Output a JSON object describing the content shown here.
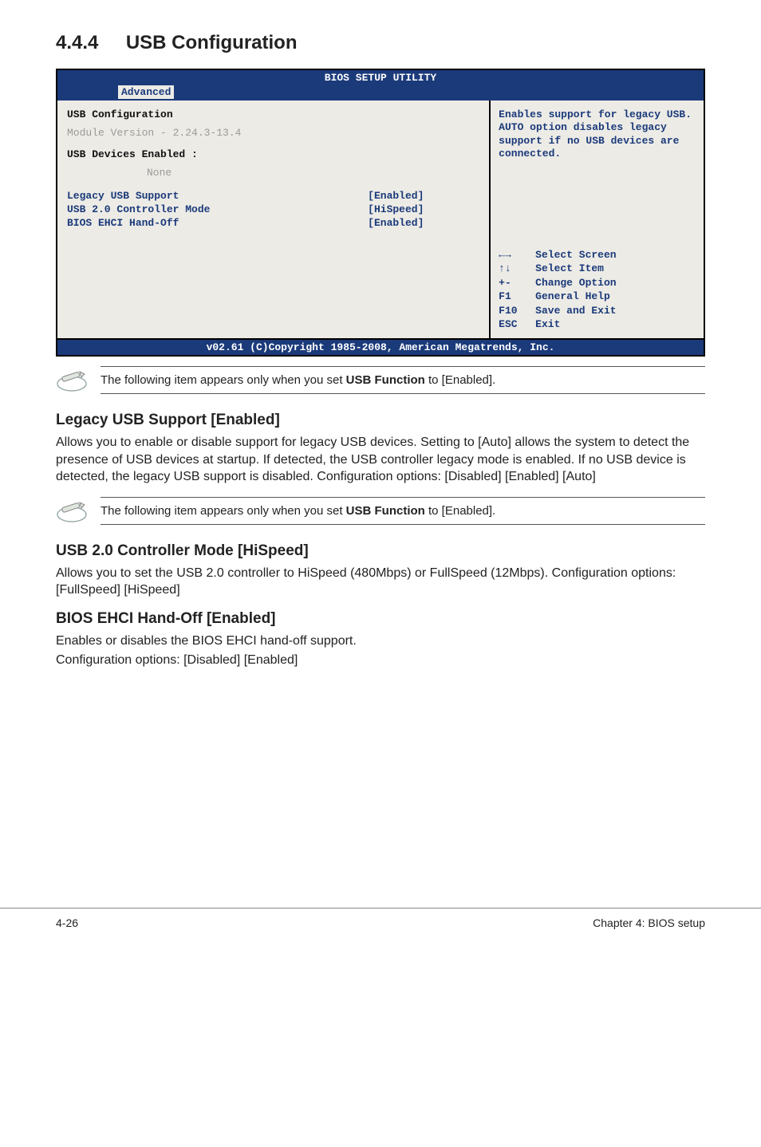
{
  "section": {
    "number": "4.4.4",
    "title": "USB Configuration"
  },
  "bios": {
    "header": "BIOS SETUP UTILITY",
    "tab": "Advanced",
    "group_title": "USB Configuration",
    "module_line": "Module Version - 2.24.3-13.4",
    "enabled_label": "USB Devices Enabled :",
    "enabled_value": "None",
    "rows": [
      {
        "k": "Legacy USB Support",
        "v": "[Enabled]"
      },
      {
        "k": "USB 2.0 Controller Mode",
        "v": "[HiSpeed]"
      },
      {
        "k": "BIOS EHCI Hand-Off",
        "v": "[Enabled]"
      }
    ],
    "help": "Enables support for legacy USB. AUTO option disables legacy support if no USB devices are connected.",
    "keys": [
      {
        "k": "←→",
        "d": "Select Screen"
      },
      {
        "k": "↑↓",
        "d": "Select Item"
      },
      {
        "k": "+-",
        "d": "Change Option"
      },
      {
        "k": "F1",
        "d": "General Help"
      },
      {
        "k": "F10",
        "d": "Save and Exit"
      },
      {
        "k": "ESC",
        "d": "Exit"
      }
    ],
    "footer": "v02.61 (C)Copyright 1985-2008, American Megatrends, Inc."
  },
  "note1": {
    "prefix": "The following item appears only when you set ",
    "bold": "USB Function",
    "suffix": " to [Enabled]."
  },
  "legacy": {
    "heading": "Legacy USB Support [Enabled]",
    "body": "Allows you to enable or disable support for legacy USB devices. Setting to [Auto] allows the system to detect the presence of USB devices at startup. If detected, the USB controller legacy mode is enabled. If no USB device is detected, the legacy USB support is disabled. Configuration options: [Disabled] [Enabled] [Auto]"
  },
  "note2": {
    "prefix": "The following item appears only when you set ",
    "bold": "USB Function",
    "suffix": " to [Enabled]."
  },
  "usb20": {
    "heading": "USB 2.0 Controller Mode [HiSpeed]",
    "body": "Allows you to set the USB 2.0 controller to HiSpeed (480Mbps) or FullSpeed (12Mbps). Configuration options: [FullSpeed] [HiSpeed]"
  },
  "ehci": {
    "heading": "BIOS EHCI Hand-Off [Enabled]",
    "body1": "Enables or disables the BIOS EHCI hand-off support.",
    "body2": "Configuration options: [Disabled] [Enabled]"
  },
  "footer": {
    "left": "4-26",
    "right": "Chapter 4: BIOS setup"
  }
}
